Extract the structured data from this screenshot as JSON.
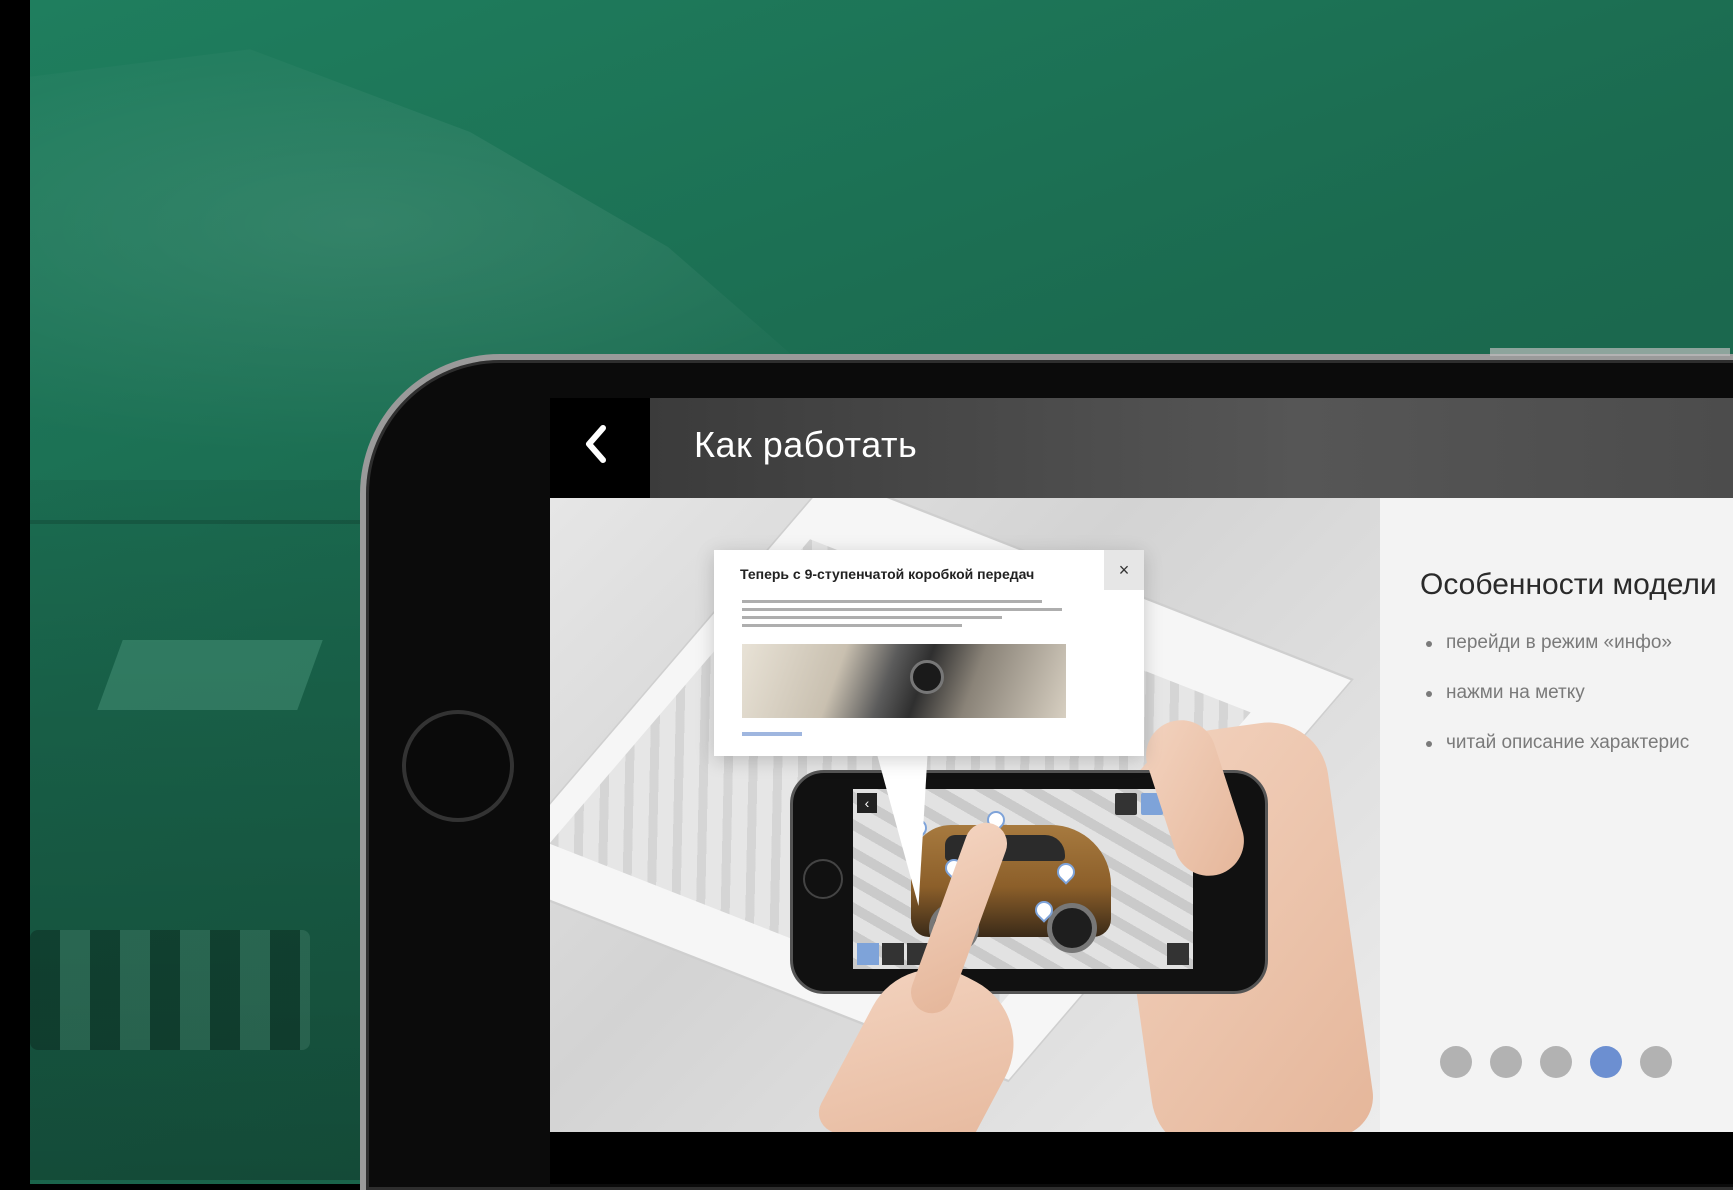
{
  "app": {
    "title": "Как работать",
    "back_icon": "chevron-left-icon"
  },
  "popup": {
    "title": "Теперь с 9-ступенчатой коробкой передач",
    "close_glyph": "×"
  },
  "info": {
    "heading": "Особенности модели",
    "items": [
      "перейди в режим «инфо»",
      "нажми на метку",
      "читай описание характерис"
    ]
  },
  "pagination": {
    "total": 5,
    "active_index": 3
  },
  "colors": {
    "background_green": "#1b6b50",
    "accent_blue": "#6c8fd1",
    "dot_inactive": "#b2b2b2"
  }
}
